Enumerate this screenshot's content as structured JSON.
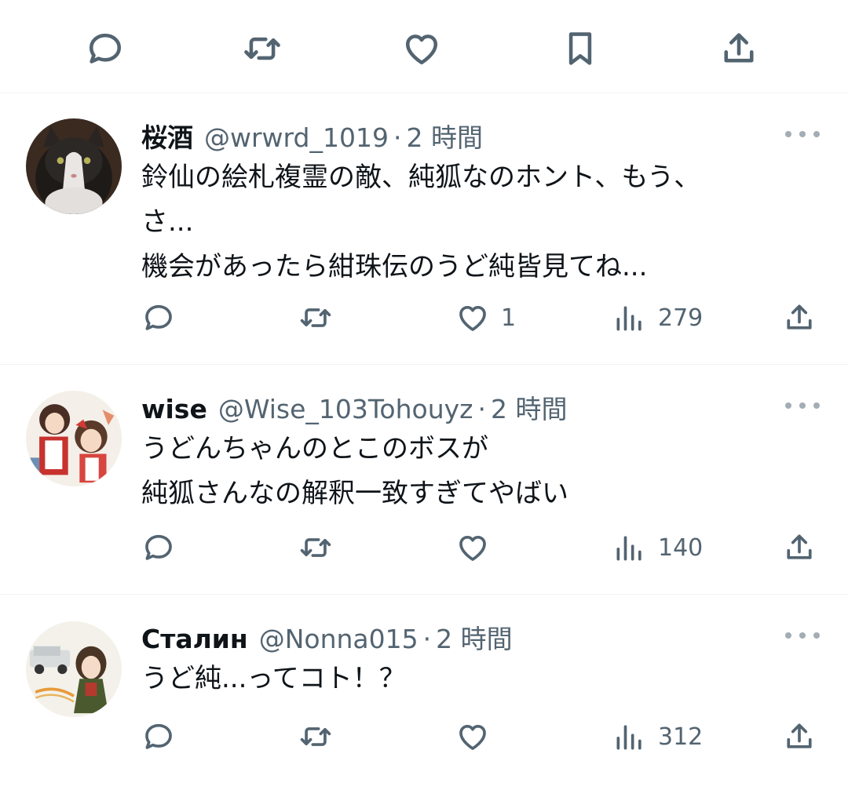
{
  "top_actions": {
    "icons": [
      "reply-icon",
      "retweet-icon",
      "like-icon",
      "bookmark-icon",
      "share-icon"
    ]
  },
  "tweets": [
    {
      "name": "桜酒",
      "handle": "@wrwrd_1019",
      "separator": "·",
      "time": "2 時間",
      "lines": [
        "鈴仙の絵札複霊の敵、純狐なのホント、もう、",
        "さ...",
        "機会があったら紺珠伝のうど純皆見てね..."
      ],
      "likes": "1",
      "views": "279",
      "avatar": "cat-photo-avatar"
    },
    {
      "name": "wise",
      "handle": "@Wise_103Tohouyz",
      "separator": "·",
      "time": "2 時間",
      "lines": [
        "うどんちゃんのとこのボスが",
        "純狐さんなの解釈一致すぎてやばい"
      ],
      "likes": "",
      "views": "140",
      "avatar": "anime-illustration-avatar"
    },
    {
      "name": "Сталин",
      "handle": "@Nonna015",
      "separator": "·",
      "time": "2 時間",
      "lines": [
        "うど純...ってコト！？"
      ],
      "likes": "",
      "views": "312",
      "avatar": "car-and-anime-girl-avatar"
    }
  ],
  "colors": {
    "text": "#0f1419",
    "secondary": "#536471",
    "divider": "#eff3f4"
  }
}
